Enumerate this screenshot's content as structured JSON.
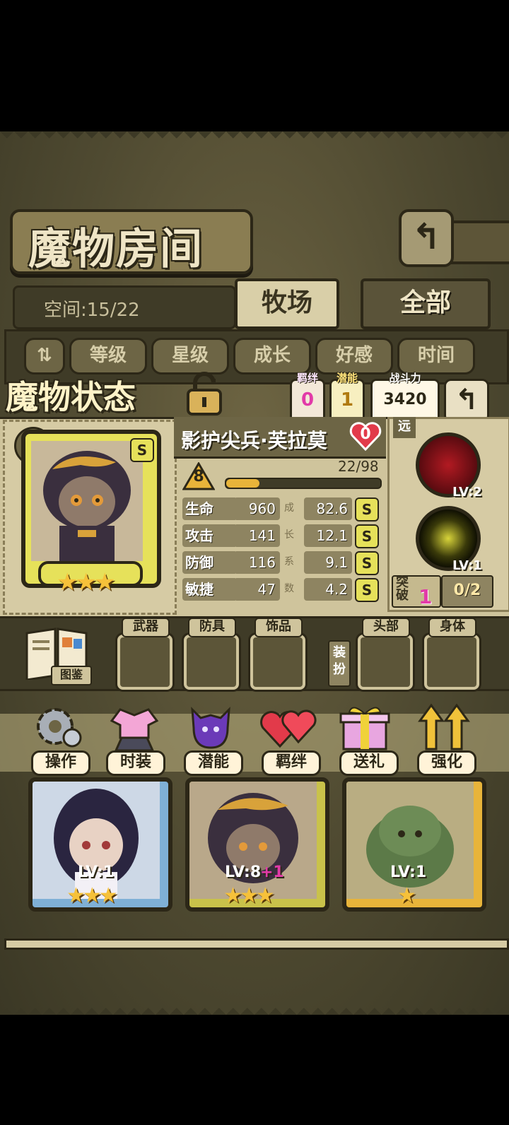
{
  "header": {
    "title": "魔物房间",
    "back_icon": "return-arrow-icon"
  },
  "space": {
    "label": "空间:15/22"
  },
  "tabs": [
    {
      "label": "牧场",
      "active": true
    },
    {
      "label": "全部",
      "active": false
    }
  ],
  "filters": {
    "sort_icon": "sort-order-icon",
    "items": [
      "等级",
      "星级",
      "成长",
      "好感",
      "时间"
    ]
  },
  "status": {
    "title": "魔物状态",
    "bond": {
      "label": "羁绊",
      "value": "0"
    },
    "potential": {
      "label": "潜能",
      "value": "1"
    },
    "power": {
      "label": "战斗力",
      "value": "3420"
    }
  },
  "monster": {
    "name": "影护尖兵·芙拉莫",
    "affection": "0",
    "rank": "S",
    "stars": 3,
    "level": "8",
    "exp_text": "22/98",
    "exp_fraction": 0.22,
    "stats": [
      {
        "label": "生命",
        "value": "960",
        "growth": "82.6",
        "grade": "S"
      },
      {
        "label": "攻击",
        "value": "141",
        "growth": "12.1",
        "grade": "S"
      },
      {
        "label": "防御",
        "value": "116",
        "growth": "9.1",
        "grade": "S"
      },
      {
        "label": "敏捷",
        "value": "47",
        "growth": "4.2",
        "grade": "S"
      }
    ],
    "growth_label": [
      "成",
      "长",
      "系",
      "数"
    ],
    "range": "远",
    "skills": [
      {
        "lv": "LV:2"
      },
      {
        "lv": "LV:1"
      }
    ],
    "breakthrough": {
      "label": "突破",
      "count": "1",
      "progress": "0/2"
    }
  },
  "equipment": {
    "book_label": "图鉴",
    "dress_label": "装扮",
    "slots": [
      "武器",
      "防具",
      "饰品",
      "头部",
      "身体"
    ]
  },
  "actions": [
    "操作",
    "时装",
    "潜能",
    "羁绊",
    "送礼",
    "强化"
  ],
  "cards": [
    {
      "lv": "LV:1",
      "stars": 3,
      "color": "#7fb0d6"
    },
    {
      "lv": "LV:8",
      "plus": "+1",
      "stars": 3,
      "color": "#c9c24a"
    },
    {
      "lv": "LV:1",
      "stars": 1,
      "color": "#e8b43a"
    }
  ],
  "colors": {
    "accent_pink": "#e23aa8",
    "gold": "#e8b43a",
    "panel": "#cfc49c"
  }
}
